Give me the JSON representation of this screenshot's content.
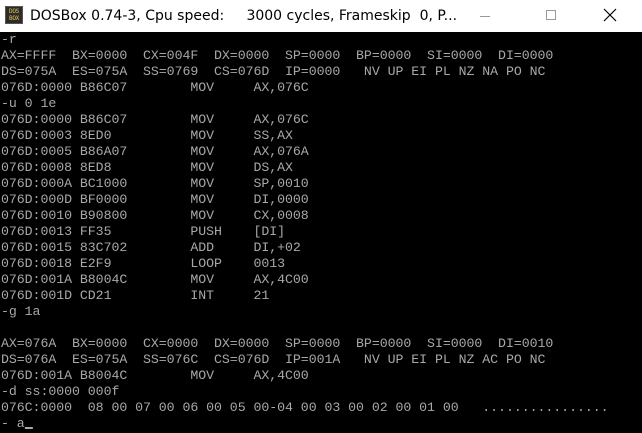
{
  "window": {
    "title": "DOSBox 0.74-3, Cpu speed:     3000 cycles, Frameskip  0, P...",
    "icon": "dosbox-icon",
    "icon_text_top": "DOS",
    "icon_text_bottom": "BOX",
    "controls": {
      "minimize": "minimize-icon",
      "maximize": "maximize-icon",
      "close": "close-icon"
    }
  },
  "terminal": {
    "text_color": "#a8a8a8",
    "background": "#000000",
    "lines": [
      "-r",
      "AX=FFFF  BX=0000  CX=004F  DX=0000  SP=0000  BP=0000  SI=0000  DI=0000",
      "DS=075A  ES=075A  SS=0769  CS=076D  IP=0000   NV UP EI PL NZ NA PO NC",
      "076D:0000 B86C07        MOV     AX,076C",
      "-u 0 1e",
      "076D:0000 B86C07        MOV     AX,076C",
      "076D:0003 8ED0          MOV     SS,AX",
      "076D:0005 B86A07        MOV     AX,076A",
      "076D:0008 8ED8          MOV     DS,AX",
      "076D:000A BC1000        MOV     SP,0010",
      "076D:000D BF0000        MOV     DI,0000",
      "076D:0010 B90800        MOV     CX,0008",
      "076D:0013 FF35          PUSH    [DI]",
      "076D:0015 83C702        ADD     DI,+02",
      "076D:0018 E2F9          LOOP    0013",
      "076D:001A B8004C        MOV     AX,4C00",
      "076D:001D CD21          INT     21",
      "-g 1a",
      "",
      "AX=076A  BX=0000  CX=0000  DX=0000  SP=0000  BP=0000  SI=0000  DI=0010",
      "DS=076A  ES=075A  SS=076C  CS=076D  IP=001A   NV UP EI PL NZ AC PO NC",
      "076D:001A B8004C        MOV     AX,4C00",
      "-d ss:0000 000f",
      "076C:0000  08 00 07 00 06 00 05 00-04 00 03 00 02 00 01 00   ................"
    ],
    "prompt": "- a"
  }
}
